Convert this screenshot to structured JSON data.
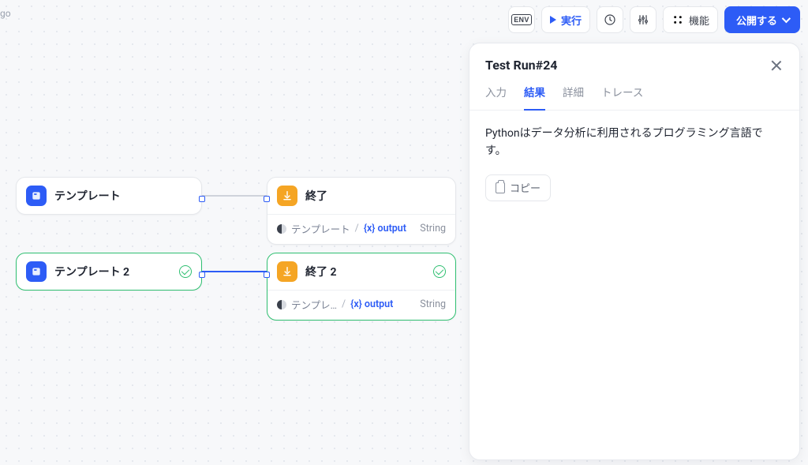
{
  "topleft": {
    "go": "go"
  },
  "toolbar": {
    "env_label": "ENV",
    "run_label": "実行",
    "features_label": "機能",
    "publish_label": "公開する"
  },
  "nodes": {
    "tpl1": {
      "label": "テンプレート"
    },
    "tpl2": {
      "label": "テンプレート 2"
    },
    "end1": {
      "label": "終了",
      "source": "テンプレート",
      "var": "{x} output",
      "type": "String"
    },
    "end2": {
      "label": "終了 2",
      "source": "テンプレ…",
      "var": "{x} output",
      "type": "String"
    }
  },
  "panel": {
    "title": "Test Run#24",
    "tabs": {
      "input": "入力",
      "result": "結果",
      "detail": "詳細",
      "trace": "トレース"
    },
    "active_tab": "result",
    "result_text": "Pythonはデータ分析に利用されるプログラミング言語です。",
    "copy_label": "コピー"
  }
}
